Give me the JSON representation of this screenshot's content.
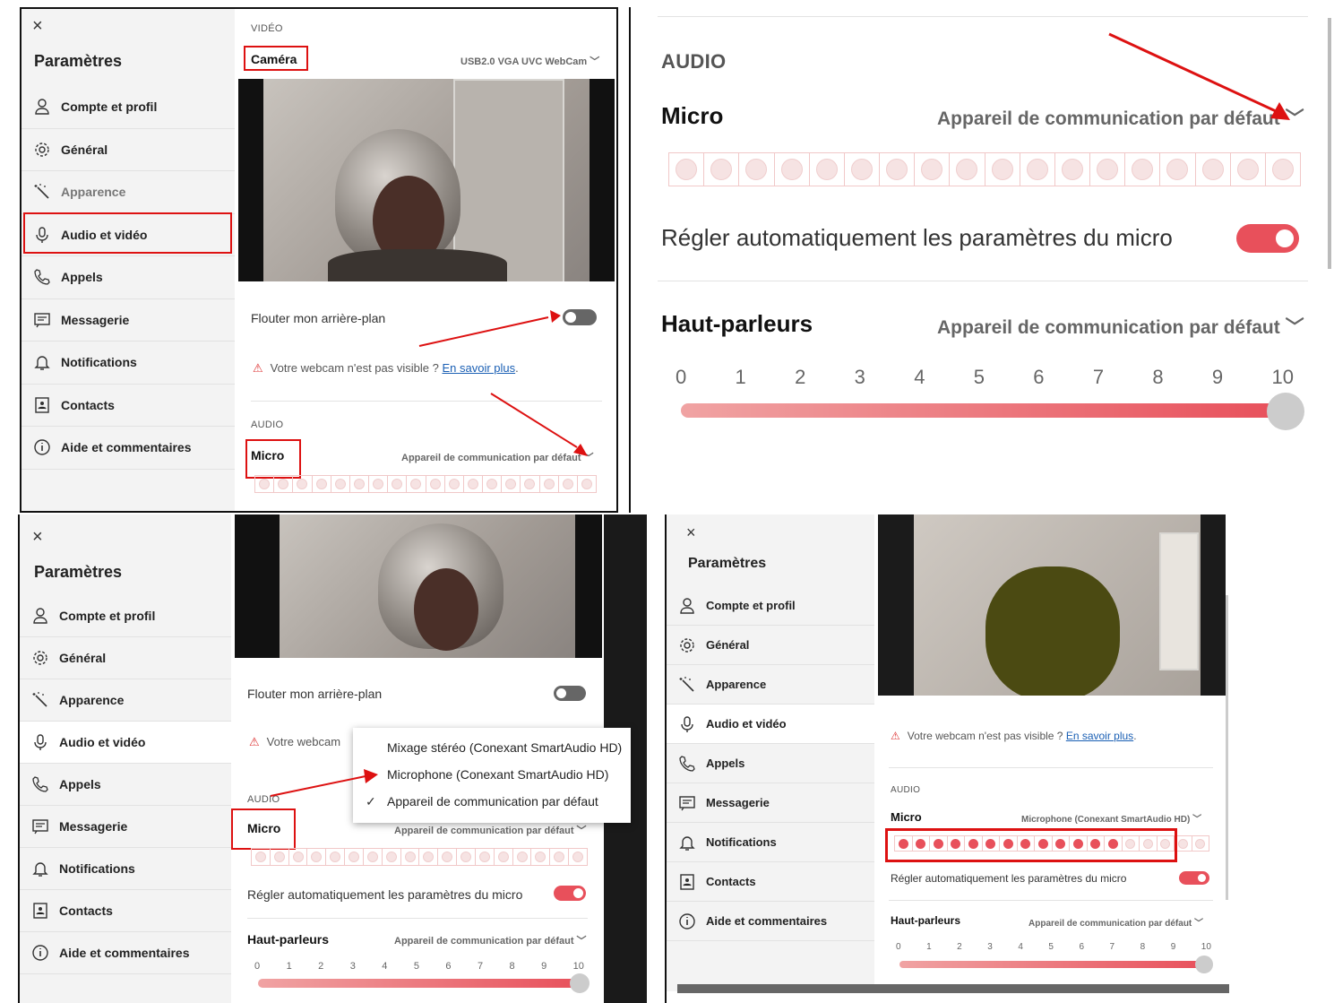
{
  "sidebar": {
    "close_glyph": "×",
    "title": "Paramètres",
    "items": [
      {
        "label": "Compte et profil",
        "icon": "person-icon"
      },
      {
        "label": "Général",
        "icon": "gear-icon"
      },
      {
        "label": "Apparence",
        "icon": "wand-icon"
      },
      {
        "label": "Audio et vidéo",
        "icon": "microphone-icon"
      },
      {
        "label": "Appels",
        "icon": "phone-icon"
      },
      {
        "label": "Messagerie",
        "icon": "message-icon"
      },
      {
        "label": "Notifications",
        "icon": "bell-icon"
      },
      {
        "label": "Contacts",
        "icon": "contact-card-icon"
      },
      {
        "label": "Aide et commentaires",
        "icon": "info-icon"
      }
    ]
  },
  "video": {
    "section": "VIDÉO",
    "camera_label": "Caméra",
    "camera_device": "USB2.0 VGA UVC WebCam",
    "blur_label": "Flouter mon arrière-plan",
    "blur_enabled": false,
    "warning_text": "Votre webcam n'est pas visible ? ",
    "warning_text_short": "Votre webcam",
    "warning_link": "En savoir plus",
    "warning_suffix": "."
  },
  "audio": {
    "section": "AUDIO",
    "section_large": "AUDIO",
    "mic_label": "Micro",
    "mic_device": "Appareil de communication par défaut",
    "mic_device_selected": "Microphone (Conexant SmartAudio HD)",
    "auto_adjust_label": "Régler automatiquement les paramètres du micro",
    "auto_adjust_enabled": true,
    "speakers_label": "Haut-parleurs",
    "speakers_device": "Appareil de communication par défaut",
    "volume_ticks": [
      "0",
      "1",
      "2",
      "3",
      "4",
      "5",
      "6",
      "7",
      "8",
      "9",
      "10"
    ],
    "volume_level": 10,
    "meter_cells": 18,
    "meter_lit_panel4": 13
  },
  "dropdown": {
    "options": [
      {
        "label": "Mixage stéréo (Conexant SmartAudio HD)",
        "checked": false
      },
      {
        "label": "Microphone (Conexant SmartAudio HD)",
        "checked": false
      },
      {
        "label": "Appareil de communication par défaut",
        "checked": true
      }
    ],
    "check_glyph": "✓"
  },
  "colors": {
    "accent": "#e8505b",
    "annotation_red": "#d11111",
    "sidebar_bg": "#f3f3f3",
    "link": "#1a5fb4"
  }
}
